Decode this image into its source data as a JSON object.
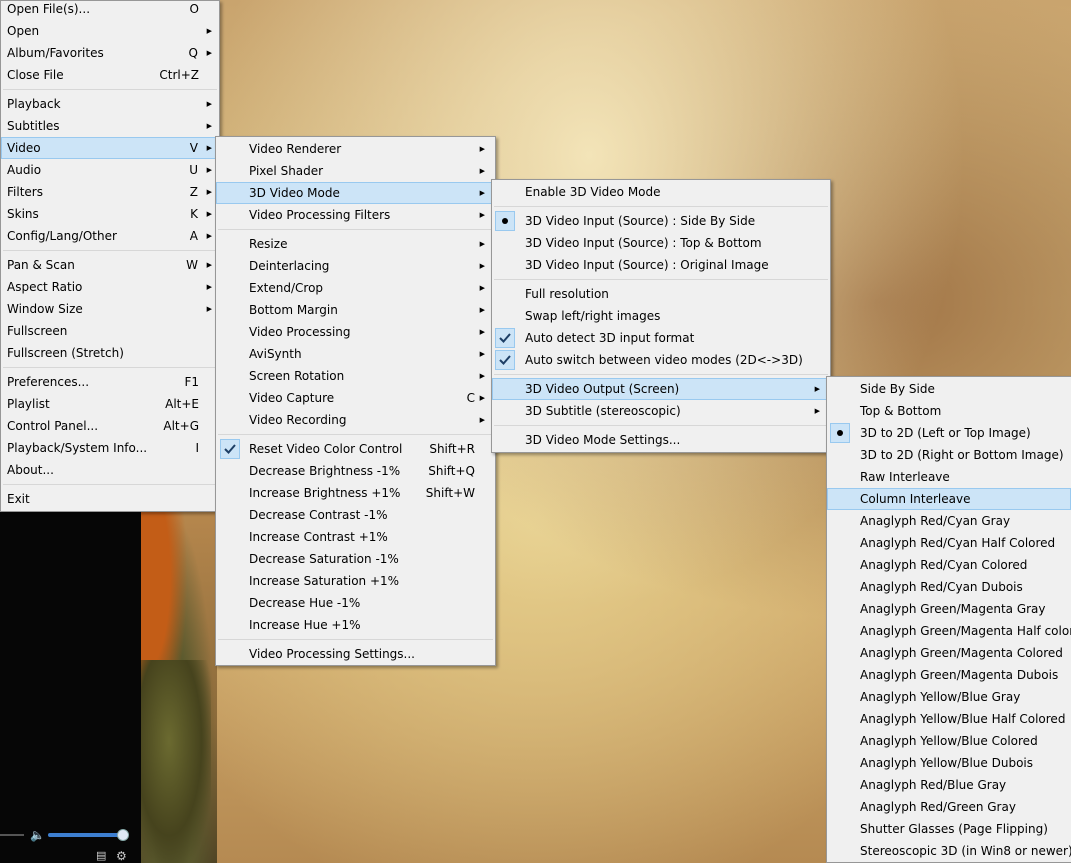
{
  "main_menu": {
    "items": [
      {
        "label": "Open File(s)...",
        "shortcut": "O",
        "submenu": false
      },
      {
        "label": "Open",
        "shortcut": "",
        "submenu": true
      },
      {
        "label": "Album/Favorites",
        "shortcut": "Q",
        "submenu": true
      },
      {
        "label": "Close File",
        "shortcut": "Ctrl+Z",
        "submenu": false
      },
      {
        "label": "Playback",
        "shortcut": "",
        "submenu": true
      },
      {
        "label": "Subtitles",
        "shortcut": "",
        "submenu": true
      },
      {
        "label": "Video",
        "shortcut": "V",
        "submenu": true
      },
      {
        "label": "Audio",
        "shortcut": "U",
        "submenu": true
      },
      {
        "label": "Filters",
        "shortcut": "Z",
        "submenu": true
      },
      {
        "label": "Skins",
        "shortcut": "K",
        "submenu": true
      },
      {
        "label": "Config/Lang/Other",
        "shortcut": "A",
        "submenu": true
      },
      {
        "label": "Pan & Scan",
        "shortcut": "W",
        "submenu": true
      },
      {
        "label": "Aspect Ratio",
        "shortcut": "",
        "submenu": true
      },
      {
        "label": "Window Size",
        "shortcut": "",
        "submenu": true
      },
      {
        "label": "Fullscreen",
        "shortcut": "",
        "submenu": false
      },
      {
        "label": "Fullscreen (Stretch)",
        "shortcut": "",
        "submenu": false
      },
      {
        "label": "Preferences...",
        "shortcut": "F1",
        "submenu": false
      },
      {
        "label": "Playlist",
        "shortcut": "Alt+E",
        "submenu": false
      },
      {
        "label": "Control Panel...",
        "shortcut": "Alt+G",
        "submenu": false
      },
      {
        "label": "Playback/System Info...",
        "shortcut": "I",
        "submenu": false
      },
      {
        "label": "About...",
        "shortcut": "",
        "submenu": false
      },
      {
        "label": "Exit",
        "shortcut": "",
        "submenu": false
      }
    ]
  },
  "video_menu": {
    "items": [
      {
        "label": "Video Renderer",
        "shortcut": "",
        "submenu": true
      },
      {
        "label": "Pixel Shader",
        "shortcut": "",
        "submenu": true
      },
      {
        "label": "3D Video Mode",
        "shortcut": "",
        "submenu": true
      },
      {
        "label": "Video Processing Filters",
        "shortcut": "",
        "submenu": true
      },
      {
        "label": "Resize",
        "shortcut": "",
        "submenu": true
      },
      {
        "label": "Deinterlacing",
        "shortcut": "",
        "submenu": true
      },
      {
        "label": "Extend/Crop",
        "shortcut": "",
        "submenu": true
      },
      {
        "label": "Bottom Margin",
        "shortcut": "",
        "submenu": true
      },
      {
        "label": "Video Processing",
        "shortcut": "",
        "submenu": true
      },
      {
        "label": "AviSynth",
        "shortcut": "",
        "submenu": true
      },
      {
        "label": "Screen Rotation",
        "shortcut": "",
        "submenu": true
      },
      {
        "label": "Video Capture",
        "shortcut": "C",
        "submenu": true
      },
      {
        "label": "Video Recording",
        "shortcut": "",
        "submenu": true
      },
      {
        "label": "Reset Video Color Control",
        "shortcut": "Shift+R",
        "submenu": false
      },
      {
        "label": "Decrease Brightness -1%",
        "shortcut": "Shift+Q",
        "submenu": false
      },
      {
        "label": "Increase Brightness +1%",
        "shortcut": "Shift+W",
        "submenu": false
      },
      {
        "label": "Decrease Contrast -1%",
        "shortcut": "",
        "submenu": false
      },
      {
        "label": "Increase Contrast +1%",
        "shortcut": "",
        "submenu": false
      },
      {
        "label": "Decrease Saturation -1%",
        "shortcut": "",
        "submenu": false
      },
      {
        "label": "Increase Saturation +1%",
        "shortcut": "",
        "submenu": false
      },
      {
        "label": "Decrease Hue -1%",
        "shortcut": "",
        "submenu": false
      },
      {
        "label": "Increase Hue +1%",
        "shortcut": "",
        "submenu": false
      },
      {
        "label": "Video Processing Settings...",
        "shortcut": "",
        "submenu": false
      }
    ]
  },
  "menu_3d": {
    "items": [
      {
        "label": "Enable 3D Video Mode"
      },
      {
        "label": "3D Video Input (Source) : Side By Side"
      },
      {
        "label": "3D Video Input (Source) : Top & Bottom"
      },
      {
        "label": "3D Video Input (Source) : Original Image"
      },
      {
        "label": "Full resolution"
      },
      {
        "label": "Swap left/right images"
      },
      {
        "label": "Auto detect 3D input format"
      },
      {
        "label": "Auto switch between video modes (2D<->3D)"
      },
      {
        "label": "3D Video Output (Screen)"
      },
      {
        "label": "3D Subtitle (stereoscopic)"
      },
      {
        "label": "3D Video Mode Settings..."
      }
    ]
  },
  "menu_output": {
    "items": [
      {
        "label": "Side By Side"
      },
      {
        "label": "Top & Bottom"
      },
      {
        "label": "3D to 2D (Left or Top Image)"
      },
      {
        "label": "3D to 2D (Right or Bottom Image)"
      },
      {
        "label": "Raw Interleave"
      },
      {
        "label": "Column Interleave"
      },
      {
        "label": "Anaglyph Red/Cyan Gray"
      },
      {
        "label": "Anaglyph Red/Cyan Half Colored"
      },
      {
        "label": "Anaglyph Red/Cyan Colored"
      },
      {
        "label": "Anaglyph Red/Cyan Dubois"
      },
      {
        "label": "Anaglyph Green/Magenta Gray"
      },
      {
        "label": "Anaglyph Green/Magenta Half colored"
      },
      {
        "label": "Anaglyph Green/Magenta Colored"
      },
      {
        "label": "Anaglyph Green/Magenta Dubois"
      },
      {
        "label": "Anaglyph Yellow/Blue Gray"
      },
      {
        "label": "Anaglyph Yellow/Blue Half Colored"
      },
      {
        "label": "Anaglyph Yellow/Blue Colored"
      },
      {
        "label": "Anaglyph Yellow/Blue Dubois"
      },
      {
        "label": "Anaglyph Red/Blue Gray"
      },
      {
        "label": "Anaglyph Red/Green Gray"
      },
      {
        "label": "Shutter Glasses (Page Flipping)"
      },
      {
        "label": "Stereoscopic 3D (in Win8 or newer)"
      }
    ]
  },
  "player": {
    "volume_level": 0.95
  },
  "icons": {
    "submenu_arrow": "triangle-right-icon",
    "checked": "checkmark-icon",
    "radio": "radio-dot-icon",
    "speaker": "speaker-icon",
    "playlist": "playlist-icon",
    "settings": "gear-icon"
  },
  "colors": {
    "menu_bg": "#f0f0f0",
    "highlight_bg": "#cce4f7",
    "highlight_border": "#99c9ef",
    "volume_accent": "#3d7fd0"
  }
}
